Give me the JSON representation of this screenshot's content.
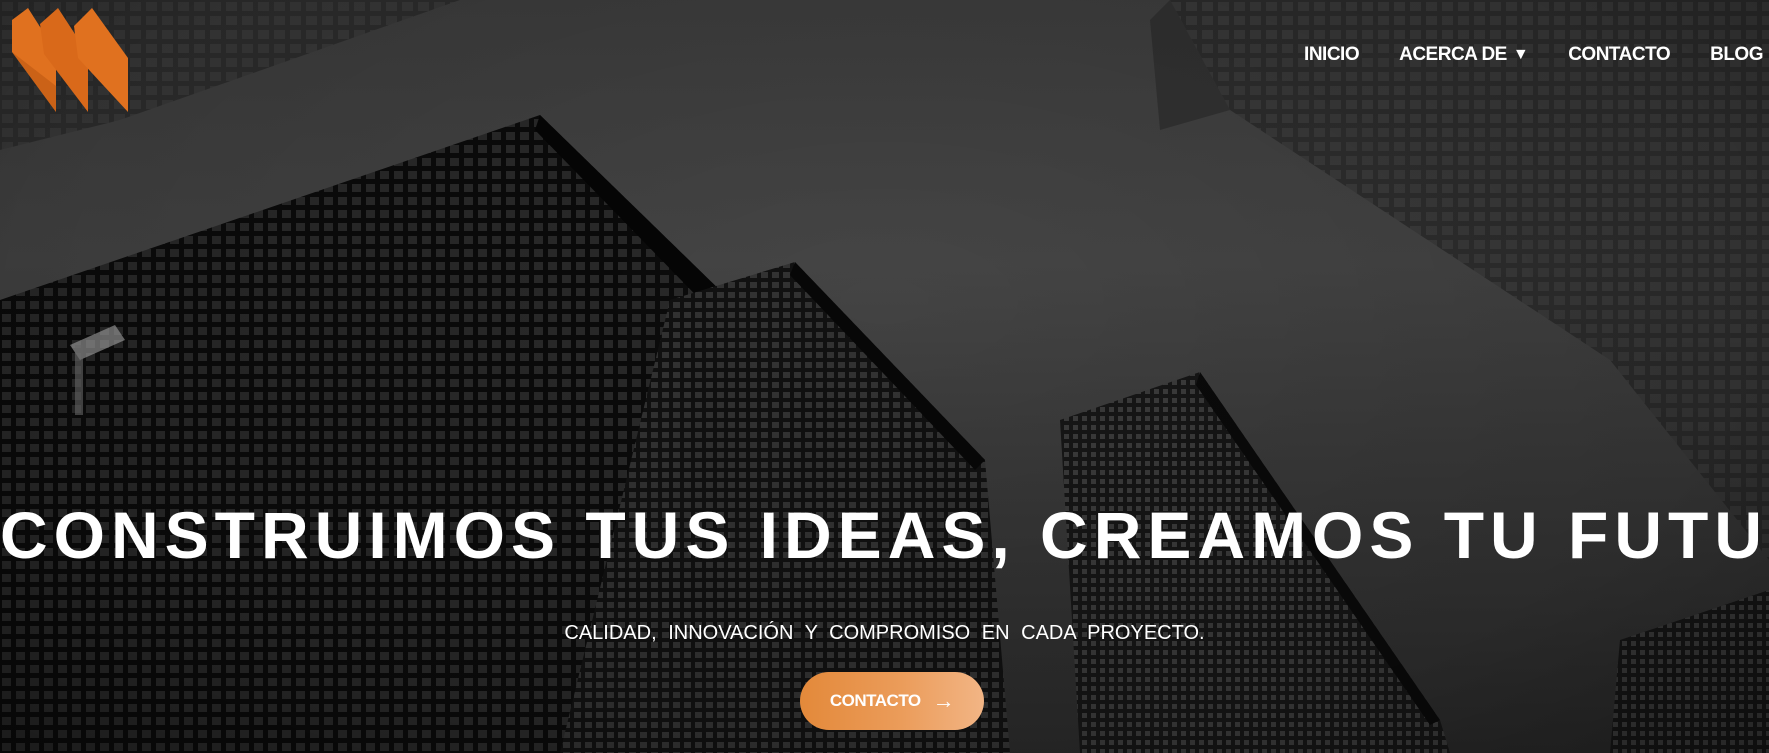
{
  "brand": {
    "logo_icon": "orange-m-logo-icon",
    "accent_color": "#e0711f"
  },
  "nav": {
    "items": [
      {
        "label": "INICIO"
      },
      {
        "label": "ACERCA DE",
        "caret": "▼"
      },
      {
        "label": "CONTACTO"
      },
      {
        "label": "BLOG"
      }
    ]
  },
  "hero": {
    "headline": "CONSTRUIMOS TUS IDEAS,  CREAMOS TU FUTURO",
    "subtitle": "CALIDAD, INNOVACIÓN Y COMPROMISO EN CADA PROYECTO.",
    "cta_label": "CONTACTO",
    "cta_arrow": "→",
    "cta_color": "#e98f3f",
    "background": "grayscale-skyscrapers-photo"
  }
}
